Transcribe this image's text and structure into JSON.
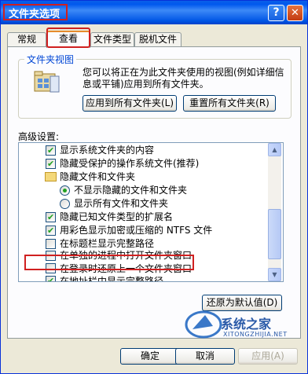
{
  "window": {
    "title": "文件夹选项",
    "help_glyph": "?",
    "close_glyph": "✕"
  },
  "tabs": [
    {
      "label": "常规",
      "active": false
    },
    {
      "label": "查看",
      "active": true
    },
    {
      "label": "文件类型",
      "active": false
    },
    {
      "label": "脱机文件",
      "active": false
    }
  ],
  "folder_views": {
    "group_label": "文件夹视图",
    "description": "您可以将正在为此文件夹使用的视图(例如详细信息或平铺)应用到所有文件夹。",
    "apply_all_button": "应用到所有文件夹(L)",
    "reset_all_button": "重置所有文件夹(R)",
    "icon": "folder-views-icon"
  },
  "advanced": {
    "label": "高级设置:",
    "items": [
      {
        "type": "checkbox",
        "checked": true,
        "text": "显示系统文件夹的内容"
      },
      {
        "type": "checkbox",
        "checked": true,
        "text": "隐藏受保护的操作系统文件(推荐)"
      },
      {
        "type": "folder",
        "text": "隐藏文件和文件夹"
      },
      {
        "type": "radio",
        "checked": true,
        "text": "不显示隐藏的文件和文件夹"
      },
      {
        "type": "radio",
        "checked": false,
        "text": "显示所有文件和文件夹"
      },
      {
        "type": "checkbox",
        "checked": true,
        "text": "隐藏已知文件类型的扩展名"
      },
      {
        "type": "checkbox",
        "checked": true,
        "text": "用彩色显示加密或压缩的 NTFS 文件"
      },
      {
        "type": "checkbox",
        "checked": false,
        "text": "在标题栏显示完整路径"
      },
      {
        "type": "checkbox",
        "checked": false,
        "text": "在单独的进程中打开文件夹窗口"
      },
      {
        "type": "checkbox",
        "checked": false,
        "text": "在登录时还原上一个文件夹窗口"
      },
      {
        "type": "checkbox",
        "checked": true,
        "text": "在地址栏中显示完整路径"
      }
    ],
    "restore_defaults_button": "还原为默认值(D)"
  },
  "footer": {
    "ok_button": "确定",
    "cancel_button": "取消",
    "apply_button": "应用(A)"
  },
  "watermark": {
    "text": "系统之家",
    "sub": "XITONGZHIJIA.NET"
  },
  "colors": {
    "title_bar": "#0058ee",
    "highlight": "#d02020",
    "tab_accent": "#e68b2c",
    "check": "#21a121"
  }
}
